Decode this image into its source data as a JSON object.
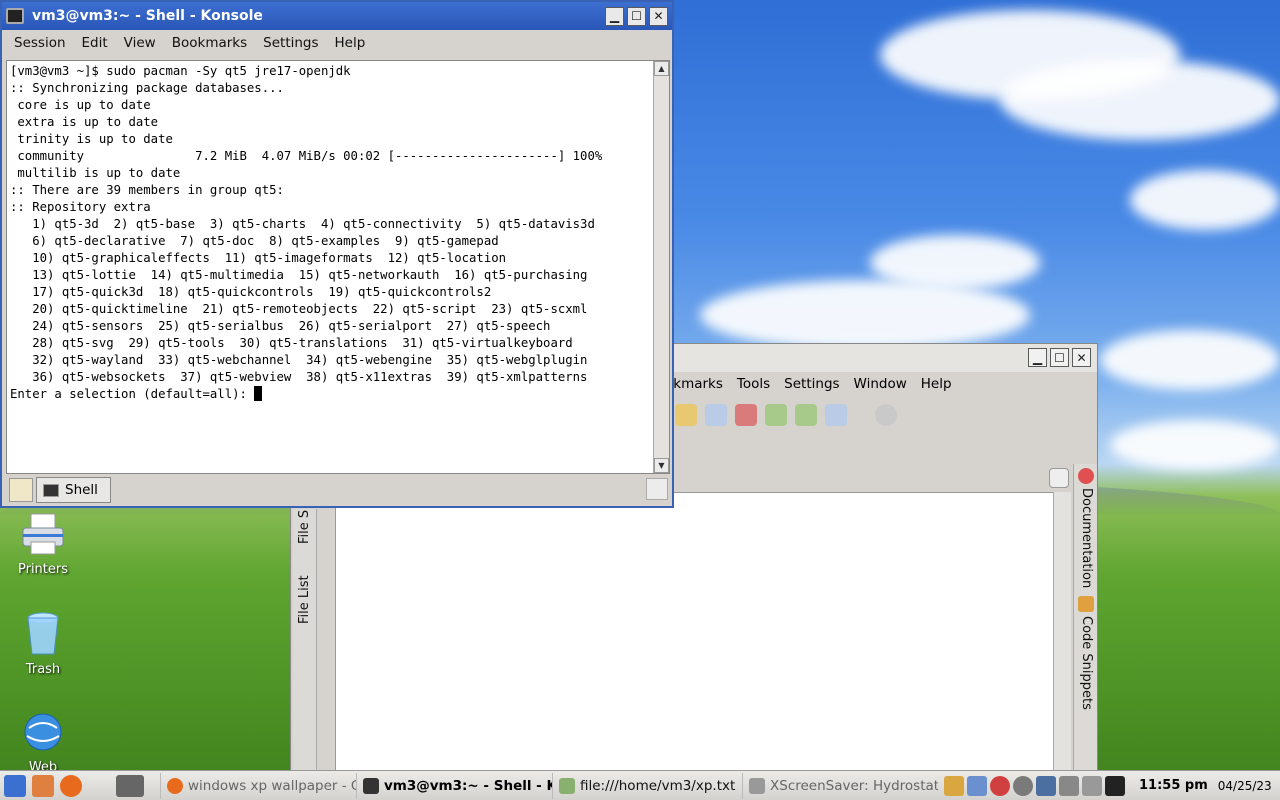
{
  "konsole": {
    "title": "vm3@vm3:~ - Shell - Konsole",
    "menu": [
      "Session",
      "Edit",
      "View",
      "Bookmarks",
      "Settings",
      "Help"
    ],
    "terminal_lines": [
      "[vm3@vm3 ~]$ sudo pacman -Sy qt5 jre17-openjdk",
      ":: Synchronizing package databases...",
      " core is up to date",
      " extra is up to date",
      " trinity is up to date",
      " community               7.2 MiB  4.07 MiB/s 00:02 [----------------------] 100%",
      " multilib is up to date",
      ":: There are 39 members in group qt5:",
      ":: Repository extra",
      "   1) qt5-3d  2) qt5-base  3) qt5-charts  4) qt5-connectivity  5) qt5-datavis3d",
      "   6) qt5-declarative  7) qt5-doc  8) qt5-examples  9) qt5-gamepad",
      "   10) qt5-graphicaleffects  11) qt5-imageformats  12) qt5-location",
      "   13) qt5-lottie  14) qt5-multimedia  15) qt5-networkauth  16) qt5-purchasing",
      "   17) qt5-quick3d  18) qt5-quickcontrols  19) qt5-quickcontrols2",
      "   20) qt5-quicktimeline  21) qt5-remoteobjects  22) qt5-script  23) qt5-scxml",
      "   24) qt5-sensors  25) qt5-serialbus  26) qt5-serialport  27) qt5-speech",
      "   28) qt5-svg  29) qt5-tools  30) qt5-translations  31) qt5-virtualkeyboard",
      "   32) qt5-wayland  33) qt5-webchannel  34) qt5-webengine  35) qt5-webglplugin",
      "   36) qt5-websockets  37) qt5-webview  38) qt5-x11extras  39) qt5-xmlpatterns",
      "",
      "Enter a selection (default=all): "
    ],
    "tab_label": "Shell"
  },
  "ide": {
    "menu": [
      "okmarks",
      "Tools",
      "Settings",
      "Window",
      "Help"
    ],
    "left_tabs": [
      "File List",
      "File S"
    ],
    "right_tabs": [
      "Documentation",
      "Code Snippets"
    ]
  },
  "desktop": {
    "icons": [
      "Printers",
      "Trash",
      "Web"
    ]
  },
  "taskbar": {
    "tasks": [
      "windows xp wallpaper - G",
      "vm3@vm3:~ - Shell - K",
      "file:///home/vm3/xp.txt",
      "XScreenSaver: Hydrostat"
    ],
    "clock": "11:55 pm",
    "date": "04/25/23"
  },
  "colors": {
    "titlebar": "#2a57b8",
    "window_bg": "#d6d3ce"
  }
}
